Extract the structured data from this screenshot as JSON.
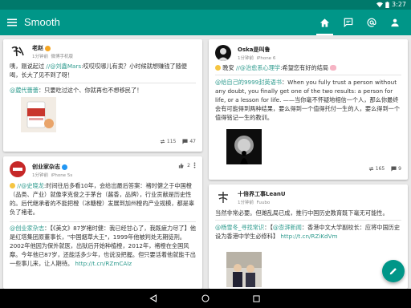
{
  "status_bar": {
    "time": "3:27"
  },
  "app": {
    "title": "Smooth",
    "tabs": [
      {
        "name": "home",
        "icon": "home-icon"
      },
      {
        "name": "messages",
        "icon": "message-icon"
      },
      {
        "name": "mentions",
        "icon": "at-icon"
      },
      {
        "name": "profile",
        "icon": "person-icon"
      }
    ]
  },
  "posts": [
    {
      "user": "老赵",
      "verified": true,
      "time": "1分钟前",
      "source": "微博手机版",
      "text_a": "咦，刚说起过 ",
      "link_a": "//@刘鑫Mars",
      "text_b": ":哎哎哎哪儿有卖？小时候就想赚钱了随便喝，长大了见不到了呀！",
      "repost_link": "@葳代蕾蕾",
      "repost_text": "：只要吃过这个、你就再也不想移民了！",
      "reposts": "115",
      "comments": "47"
    },
    {
      "user": "创业家杂志",
      "verified": true,
      "time": "1分钟前",
      "source": "iPhone 5s",
      "more_count": "2",
      "text_a": "",
      "link_a": "//@史晓龙",
      "text_b": ":时间往后多看10年，会给出最后答案：褚时健之于中国橙（品类、产业）就像李克俊之于茅台（酱香，品牌），行业贡献是历史性的。后代继承者的不能把橙（冰糖橙）发展到加州橙的产业规模，都是辜负了褚老。",
      "repost_link": "@创业家杂志",
      "repost_text": "：【《美文》87岁褚时健：我已经甘心了，我既疲力尽了】他是红塔集团原董事长，\"中国烟草大王\"，1999年他被判处无期徒刑。2002年他因为保外就医，出狱后开始种植橙，2012年，褚橙在全国风靡。今年他已87岁，还能活多少年，也说没把握。但只要活着他就能干出一些事儿来，让人期待。",
      "repost_url": "http://t.cn/RZmCAIz"
    },
    {
      "user": "Oska是叫鲁",
      "time": "1分钟前",
      "source": "iPhone 6",
      "text_a": "晚安 ",
      "link_a": "//@治愈系心理学",
      "text_b": ":希望您有好的结局",
      "repost_link": "@给自己的9999封英语书",
      "repost_text": "：When you fully trust a person without any doubt, you finally get one of the two results: a person for life, or a lesson for life. ——当你毫不怀疑地相信一个人，那么你最终会有可能得到两种结果，要么得到一个值得托付一生的人，要么得到一个值得铭记一生的教训。",
      "reposts": "165",
      "comments": "9"
    },
    {
      "user": "十倍界工事LeanU",
      "time": "1分钟前",
      "source": "Fuubo",
      "text_a": "当然非常必要。但潍乱局已成，推行中国历史教育既下毫无可能性。",
      "link_a": "",
      "text_b": "",
      "repost_link": "@杨雪冬_寻找常识",
      "repost_text": "：【",
      "repost_link2": "@澎湃新闻",
      "repost_text2": "：香港中文大学副校长：应将中国历史设为香港中学生必修科】",
      "repost_url": "http://t.cn/RZiKdVm"
    }
  ],
  "colors": {
    "primary": "#009688",
    "primary_dark": "#00796b",
    "link": "#2e9b8e"
  }
}
